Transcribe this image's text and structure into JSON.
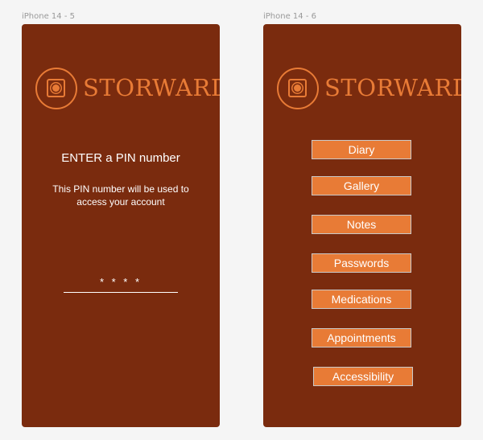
{
  "frames": {
    "left_label": "iPhone 14 - 5",
    "right_label": "iPhone 14 - 6"
  },
  "brand": {
    "name": "STORWARD",
    "logo_icon": "safe-icon"
  },
  "pin_screen": {
    "title": "ENTER a PIN number",
    "description": "This PIN number will be used to access your account",
    "pin_value": "* * * *"
  },
  "menu": {
    "items": [
      {
        "label": "Diary"
      },
      {
        "label": "Gallery"
      },
      {
        "label": "Notes"
      },
      {
        "label": "Passwords"
      },
      {
        "label": "Medications"
      },
      {
        "label": "Appointments"
      },
      {
        "label": "Accessibility"
      }
    ]
  },
  "colors": {
    "background": "#7a2b0e",
    "accent": "#e87b36",
    "text": "#ffffff",
    "canvas": "#f5f5f5"
  }
}
